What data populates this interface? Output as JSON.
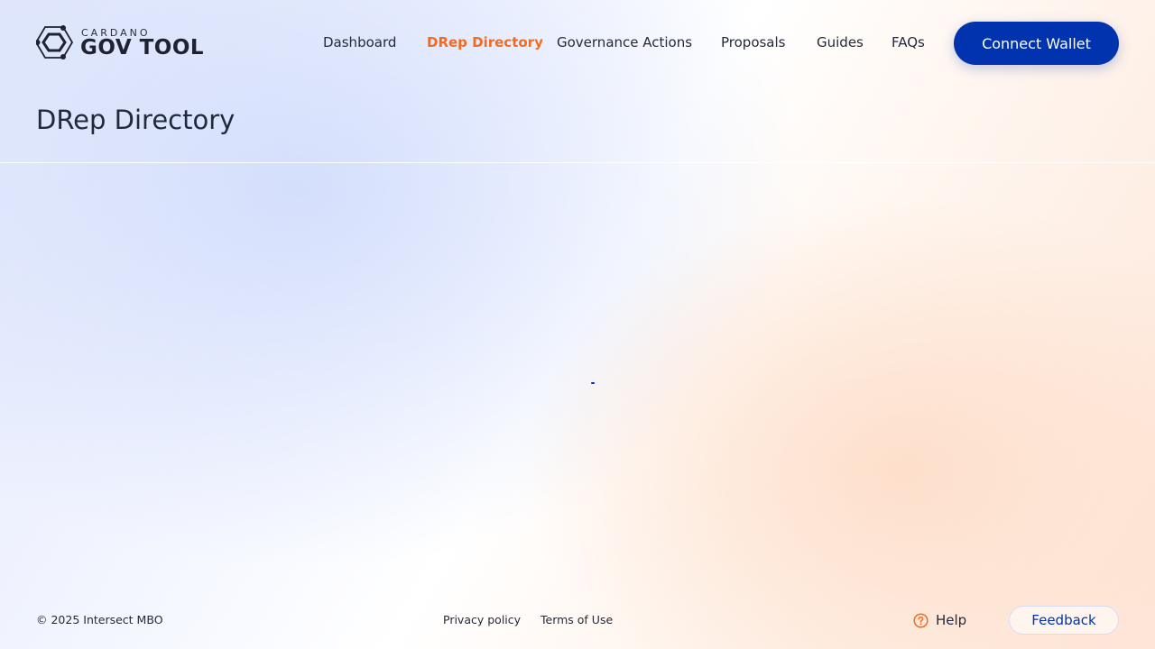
{
  "header": {
    "logo": {
      "small_text": "CARDANO",
      "big_text": "GOV TOOL",
      "icon": "hexagon-logo-icon"
    },
    "nav": [
      {
        "label": "Dashboard",
        "active": false
      },
      {
        "label": "DRep Directory",
        "active": true
      },
      {
        "label": "Governance Actions",
        "active": false
      },
      {
        "label": "Proposals",
        "active": false
      },
      {
        "label": "Guides",
        "active": false
      },
      {
        "label": "FAQs",
        "active": false
      }
    ],
    "connect_button": "Connect Wallet"
  },
  "page": {
    "title": "DRep Directory",
    "loading_indicator": "spinner-icon"
  },
  "footer": {
    "copyright": "© 2025 Intersect MBO",
    "links": [
      "Privacy policy",
      "Terms of Use"
    ],
    "help": {
      "label": "Help",
      "icon": "question-circle-icon"
    },
    "feedback": "Feedback"
  },
  "colors": {
    "primary": "#0033ad",
    "accent": "#f26b21",
    "text": "#212a3d"
  }
}
